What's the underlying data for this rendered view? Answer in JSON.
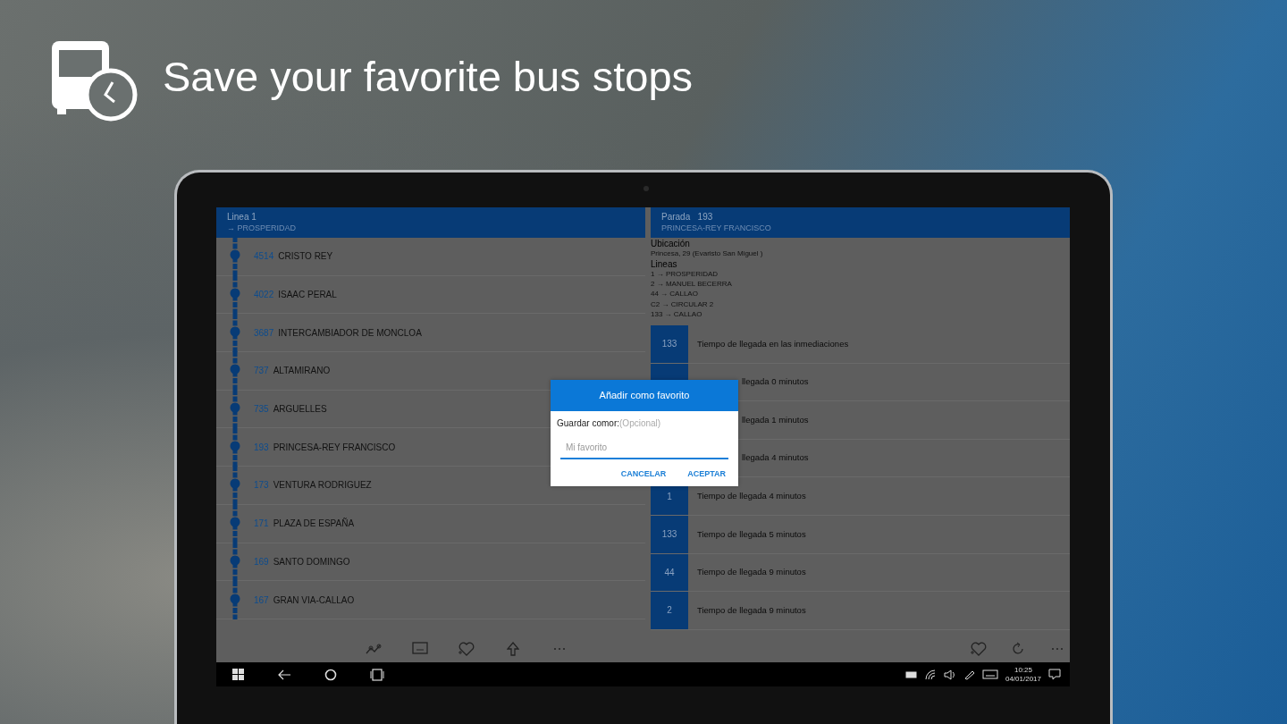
{
  "page_title": "Save your favorite bus stops",
  "line_pane": {
    "title": "Linea 1",
    "subtitle": "→ PROSPERIDAD",
    "stops": [
      {
        "code": "4514",
        "name": "CRISTO REY"
      },
      {
        "code": "4022",
        "name": "ISAAC PERAL"
      },
      {
        "code": "3687",
        "name": "INTERCAMBIADOR DE MONCLOA"
      },
      {
        "code": "737",
        "name": "ALTAMIRANO"
      },
      {
        "code": "735",
        "name": "ARGUELLES"
      },
      {
        "code": "193",
        "name": "PRINCESA-REY FRANCISCO"
      },
      {
        "code": "173",
        "name": "VENTURA RODRIGUEZ"
      },
      {
        "code": "171",
        "name": "PLAZA DE ESPAÑA"
      },
      {
        "code": "169",
        "name": "SANTO DOMINGO"
      },
      {
        "code": "167",
        "name": "GRAN VIA-CALLAO"
      }
    ]
  },
  "stop_pane": {
    "title": "Parada",
    "code": "193",
    "subtitle": "PRINCESA-REY FRANCISCO",
    "location_label": "Ubicación",
    "address": "Princesa, 29 (Evaristo San Miguel )",
    "lines_label": "Lineas",
    "lines": [
      "1 → PROSPERIDAD",
      "2 → MANUEL BECERRA",
      "44 → CALLAO",
      "C2 → CIRCULAR 2",
      "133 → CALLAO"
    ],
    "arrivals": [
      {
        "kind": "full",
        "line": "133",
        "text": "Tiempo de llegada en las inmediaciones"
      },
      {
        "kind": "covered",
        "text": "llegada 0 minutos"
      },
      {
        "kind": "covered",
        "text": "llegada 1 minutos"
      },
      {
        "kind": "covered",
        "text": "llegada 4 minutos"
      },
      {
        "kind": "full",
        "line": "1",
        "text": "Tiempo de llegada 4 minutos"
      },
      {
        "kind": "full",
        "line": "133",
        "text": "Tiempo de llegada 5 minutos"
      },
      {
        "kind": "full",
        "line": "44",
        "text": "Tiempo de llegada 9 minutos"
      },
      {
        "kind": "full",
        "line": "2",
        "text": "Tiempo de llegada 9 minutos"
      }
    ]
  },
  "dialog": {
    "title": "Añadir como favorito",
    "label": "Guardar comor:",
    "hint": "(Opcional)",
    "placeholder": "Mi favorito",
    "buttons": [
      "CANCELAR",
      "ACEPTAR"
    ]
  },
  "taskbar": {
    "time": "10:25",
    "date": "04/01/2017"
  }
}
